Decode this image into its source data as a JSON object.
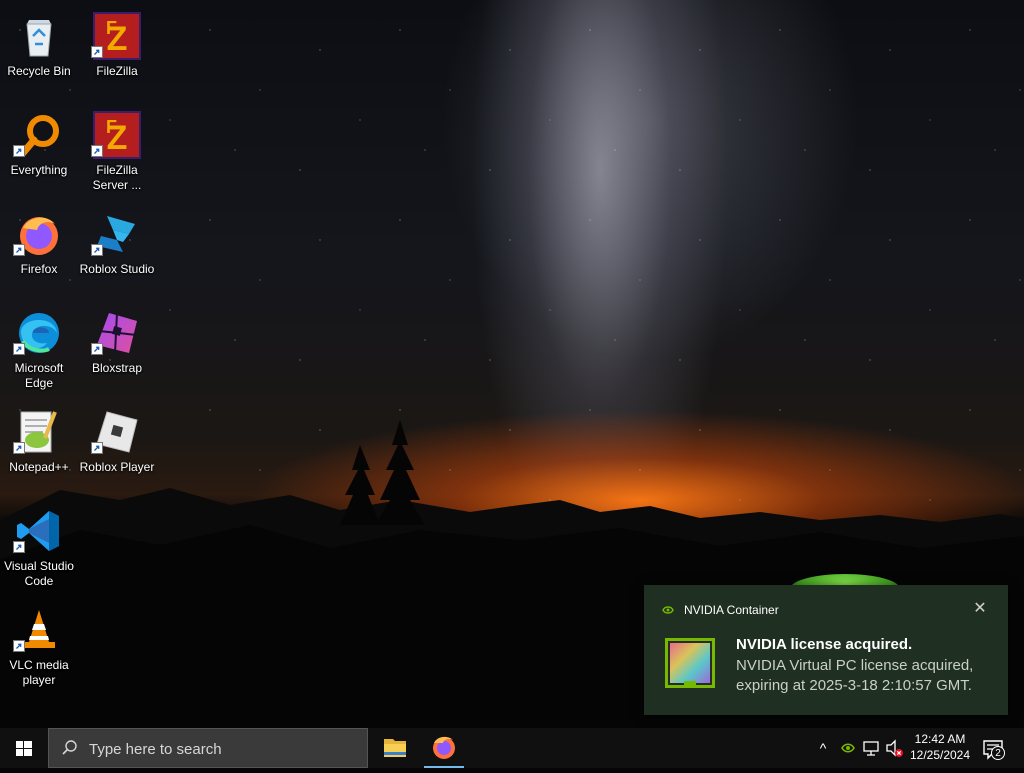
{
  "desktop": {
    "icons": [
      {
        "label": "Recycle Bin"
      },
      {
        "label": "FileZilla"
      },
      {
        "label": "Everything"
      },
      {
        "label": "FileZilla Server ..."
      },
      {
        "label": "Firefox"
      },
      {
        "label": "Roblox Studio"
      },
      {
        "label": "Microsoft Edge"
      },
      {
        "label": "Bloxstrap"
      },
      {
        "label": "Notepad++"
      },
      {
        "label": "Roblox Player"
      },
      {
        "label": "Visual Studio Code"
      },
      {
        "label": "VLC media player"
      }
    ]
  },
  "toast": {
    "app_name": "NVIDIA Container",
    "close_glyph": "✕",
    "title": "NVIDIA license acquired.",
    "body": "NVIDIA Virtual PC license acquired, expiring at 2025-3-18 2:10:57 GMT.",
    "accent_color": "#76b900"
  },
  "taskbar": {
    "search_placeholder": "Type here to search",
    "pinned_apps": [
      "file-explorer",
      "firefox"
    ],
    "tray": {
      "chevron": "^",
      "time": "12:42 AM",
      "date": "12/25/2024",
      "notification_count": "2"
    }
  }
}
